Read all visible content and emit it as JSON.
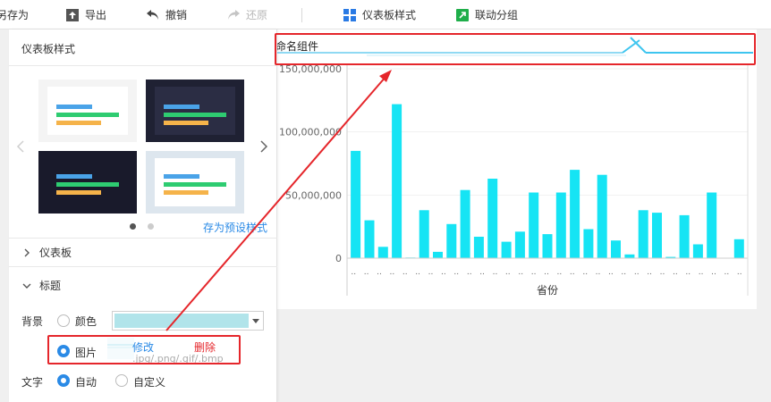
{
  "toolbar": {
    "save_as": "另存为",
    "export": "导出",
    "undo": "撤销",
    "redo": "还原",
    "dashboard_style": "仪表板样式",
    "linkage_group": "联动分组"
  },
  "panel": {
    "title": "仪表板样式",
    "save_preset": "存为预设样式",
    "section_dashboard": "仪表板",
    "section_title": "标题",
    "background_label": "背景",
    "color_option": "颜色",
    "image_option": "图片",
    "modify": "修改",
    "delete": "删除",
    "image_hint": ".jpg/.png/.gif/.bmp",
    "text_label": "文字",
    "auto_option": "自动",
    "custom_option": "自定义",
    "selected_background": "图片",
    "selected_text": "自动",
    "swatch_color": "#b1e4ea"
  },
  "widget": {
    "title": "命名组件"
  },
  "chart_data": {
    "type": "bar",
    "xlabel": "省份",
    "ylabel": "",
    "ylim": [
      0,
      150000000
    ],
    "yticks": [
      "0",
      "50,000,000",
      "100,000,000",
      "150,000,000"
    ],
    "bar_color": "#16e4f4",
    "categories": [
      "..",
      "..",
      "..",
      "..",
      "..",
      "..",
      "..",
      "..",
      "..",
      "..",
      "..",
      "..",
      "..",
      "..",
      "..",
      "..",
      "..",
      "..",
      "..",
      "..",
      "..",
      "..",
      "..",
      "..",
      "..",
      "..",
      "..",
      "..",
      "..",
      "..",
      ".."
    ],
    "values": [
      85000000,
      30000000,
      9000000,
      122000000,
      500000,
      38000000,
      5000000,
      27000000,
      54000000,
      17000000,
      63000000,
      13000000,
      21000000,
      52000000,
      19000000,
      52000000,
      70000000,
      23000000,
      66000000,
      14000000,
      3000000,
      38000000,
      36000000,
      1000000,
      34000000,
      11000000,
      52000000,
      0,
      15000000
    ]
  }
}
